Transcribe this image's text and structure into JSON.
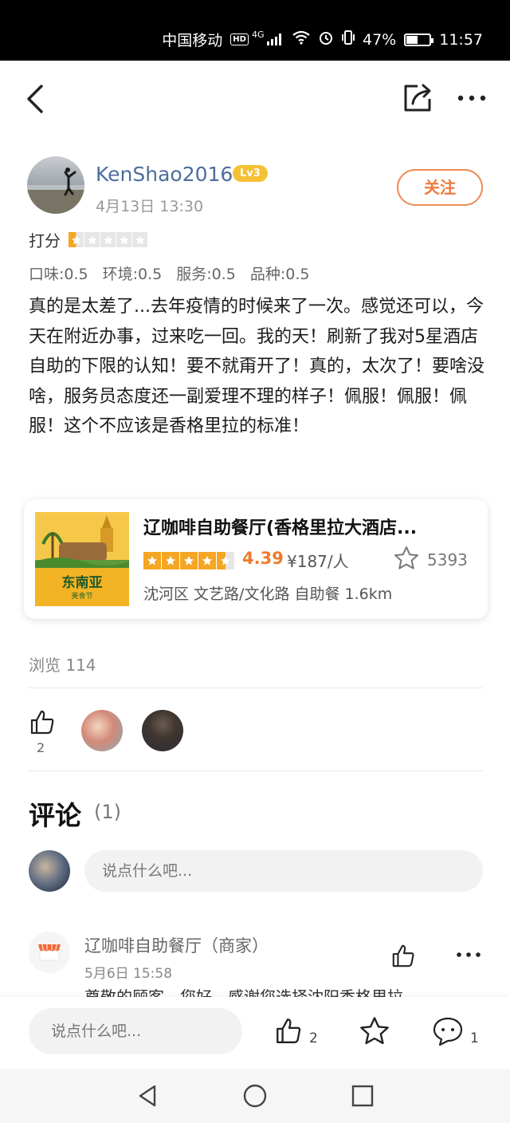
{
  "status_bar": {
    "carrier": "中国移动",
    "hd": "HD",
    "network": "4G",
    "battery_percent": "47%",
    "battery_level": 0.47,
    "time": "11:57"
  },
  "nav": {
    "back_icon": "chevron-left-icon",
    "share_icon": "share-icon",
    "more_icon": "more-icon"
  },
  "review": {
    "username": "KenShao2016",
    "level": "Lv3",
    "date": "4月13日  13:30",
    "follow_label": "关注",
    "rating_label": "打分",
    "rating": 0.5,
    "subscores": [
      "口味:0.5",
      "环境:0.5",
      "服务:0.5",
      "品种:0.5"
    ],
    "text": "真的是太差了...去年疫情的时候来了一次。感觉还可以，今天在附近办事，过来吃一回。我的天！刷新了我对5星酒店自助的下限的认知！要不就甭开了！真的，太次了！要啥没啥，服务员态度还一副爱理不理的样子！佩服！佩服！佩服！这个不应该是香格里拉的标准！"
  },
  "shop": {
    "name": "辽咖啡自助餐厅(香格里拉大酒店...",
    "image_text": "东南亚",
    "image_subtext": "美食节",
    "rating": 4.39,
    "score": "4.39",
    "price": "¥187/人",
    "favorites": "5393",
    "address": "沈河区 文艺路/文化路 自助餐  1.6km"
  },
  "stats": {
    "views": "浏览 114",
    "likes": "2"
  },
  "comments": {
    "title": "评论",
    "count": "(1)",
    "input_placeholder": "说点什么吧...",
    "items": [
      {
        "author": "辽咖啡自助餐厅（商家）",
        "date": "5月6日  15:58",
        "text": "尊敬的顾客，您好，感谢您选择沈阳香格里拉"
      }
    ]
  },
  "bottom_bar": {
    "input_placeholder": "说点什么吧...",
    "like_count": "2",
    "comment_count": "1"
  },
  "colors": {
    "accent_orange": "#ef7a2e",
    "username_blue": "#4d6e9c",
    "star_yellow": "#f5a623"
  }
}
